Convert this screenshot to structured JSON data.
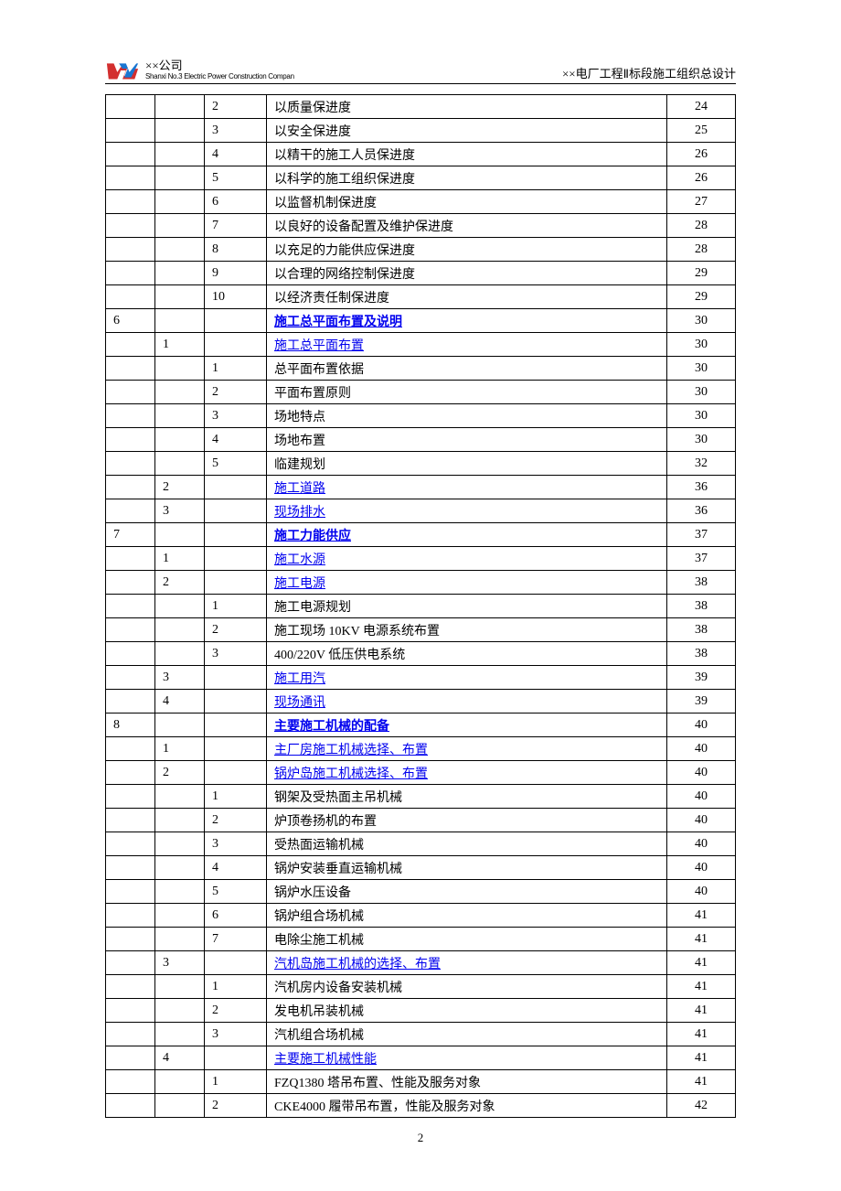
{
  "header": {
    "company_cn": "××公司",
    "company_en": "Shanxi No.3 Electric Power Construction Compan",
    "title_right": "××电厂工程Ⅱ标段施工组织总设计"
  },
  "rows": [
    {
      "c1": "",
      "c2": "",
      "c3": "2",
      "c4": "以质量保进度",
      "c5": "24",
      "link": false
    },
    {
      "c1": "",
      "c2": "",
      "c3": "3",
      "c4": "以安全保进度",
      "c5": "25",
      "link": false
    },
    {
      "c1": "",
      "c2": "",
      "c3": "4",
      "c4": "以精干的施工人员保进度",
      "c5": "26",
      "link": false
    },
    {
      "c1": "",
      "c2": "",
      "c3": "5",
      "c4": "以科学的施工组织保进度",
      "c5": "26",
      "link": false
    },
    {
      "c1": "",
      "c2": "",
      "c3": "6",
      "c4": "以监督机制保进度",
      "c5": "27",
      "link": false
    },
    {
      "c1": "",
      "c2": "",
      "c3": "7",
      "c4": "以良好的设备配置及维护保进度",
      "c5": "28",
      "link": false
    },
    {
      "c1": "",
      "c2": "",
      "c3": "8",
      "c4": "以充足的力能供应保进度",
      "c5": "28",
      "link": false
    },
    {
      "c1": "",
      "c2": "",
      "c3": "9",
      "c4": "以合理的网络控制保进度",
      "c5": "29",
      "link": false
    },
    {
      "c1": "",
      "c2": "",
      "c3": "10",
      "c4": "以经济责任制保进度",
      "c5": "29",
      "link": false
    },
    {
      "c1": "6",
      "c2": "",
      "c3": "",
      "c4": "施工总平面布置及说明",
      "c5": "30",
      "link": true,
      "bold": true
    },
    {
      "c1": "",
      "c2": "1",
      "c3": "",
      "c4": "施工总平面布置",
      "c5": "30",
      "link": true
    },
    {
      "c1": "",
      "c2": "",
      "c3": "1",
      "c4": "总平面布置依据",
      "c5": "30",
      "link": false
    },
    {
      "c1": "",
      "c2": "",
      "c3": "2",
      "c4": "平面布置原则",
      "c5": "30",
      "link": false
    },
    {
      "c1": "",
      "c2": "",
      "c3": "3",
      "c4": "场地特点",
      "c5": "30",
      "link": false
    },
    {
      "c1": "",
      "c2": "",
      "c3": "4",
      "c4": "场地布置",
      "c5": "30",
      "link": false
    },
    {
      "c1": "",
      "c2": "",
      "c3": "5",
      "c4": "临建规划",
      "c5": "32",
      "link": false
    },
    {
      "c1": "",
      "c2": "2",
      "c3": "",
      "c4": "施工道路",
      "c5": "36",
      "link": true
    },
    {
      "c1": "",
      "c2": "3",
      "c3": "",
      "c4": "现场排水",
      "c5": "36",
      "link": true
    },
    {
      "c1": "7",
      "c2": "",
      "c3": "",
      "c4": "施工力能供应",
      "c5": "37",
      "link": true,
      "bold": true
    },
    {
      "c1": "",
      "c2": "1",
      "c3": "",
      "c4": "施工水源",
      "c5": "37",
      "link": true
    },
    {
      "c1": "",
      "c2": "2",
      "c3": "",
      "c4": "施工电源",
      "c5": "38",
      "link": true
    },
    {
      "c1": "",
      "c2": "",
      "c3": "1",
      "c4": "施工电源规划",
      "c5": "38",
      "link": false
    },
    {
      "c1": "",
      "c2": "",
      "c3": "2",
      "c4": "施工现场 10KV 电源系统布置",
      "c5": "38",
      "link": false
    },
    {
      "c1": "",
      "c2": "",
      "c3": "3",
      "c4": "400/220V 低压供电系统",
      "c5": "38",
      "link": false
    },
    {
      "c1": "",
      "c2": "3",
      "c3": "",
      "c4": "施工用汽",
      "c5": "39",
      "link": true
    },
    {
      "c1": "",
      "c2": "4",
      "c3": "",
      "c4": "现场通讯",
      "c5": "39",
      "link": true
    },
    {
      "c1": "8",
      "c2": "",
      "c3": "",
      "c4": "主要施工机械的配备",
      "c5": "40",
      "link": true,
      "bold": true
    },
    {
      "c1": "",
      "c2": "1",
      "c3": "",
      "c4": "主厂房施工机械选择、布置",
      "c5": "40",
      "link": true
    },
    {
      "c1": "",
      "c2": "2",
      "c3": "",
      "c4": "锅炉岛施工机械选择、布置",
      "c5": "40",
      "link": true
    },
    {
      "c1": "",
      "c2": "",
      "c3": "1",
      "c4": "钢架及受热面主吊机械",
      "c5": "40",
      "link": false
    },
    {
      "c1": "",
      "c2": "",
      "c3": "2",
      "c4": "炉顶卷扬机的布置",
      "c5": "40",
      "link": false
    },
    {
      "c1": "",
      "c2": "",
      "c3": "3",
      "c4": "受热面运输机械",
      "c5": "40",
      "link": false
    },
    {
      "c1": "",
      "c2": "",
      "c3": "4",
      "c4": "锅炉安装垂直运输机械",
      "c5": "40",
      "link": false
    },
    {
      "c1": "",
      "c2": "",
      "c3": "5",
      "c4": "锅炉水压设备",
      "c5": "40",
      "link": false
    },
    {
      "c1": "",
      "c2": "",
      "c3": "6",
      "c4": "锅炉组合场机械",
      "c5": "41",
      "link": false
    },
    {
      "c1": "",
      "c2": "",
      "c3": "7",
      "c4": "电除尘施工机械",
      "c5": "41",
      "link": false
    },
    {
      "c1": "",
      "c2": "3",
      "c3": "",
      "c4": "汽机岛施工机械的选择、布置",
      "c5": "41",
      "link": true
    },
    {
      "c1": "",
      "c2": "",
      "c3": "1",
      "c4": "汽机房内设备安装机械",
      "c5": "41",
      "link": false
    },
    {
      "c1": "",
      "c2": "",
      "c3": "2",
      "c4": "发电机吊装机械",
      "c5": "41",
      "link": false
    },
    {
      "c1": "",
      "c2": "",
      "c3": "3",
      "c4": "汽机组合场机械",
      "c5": "41",
      "link": false
    },
    {
      "c1": "",
      "c2": "4",
      "c3": "",
      "c4": "主要施工机械性能",
      "c5": "41",
      "link": true
    },
    {
      "c1": "",
      "c2": "",
      "c3": "1",
      "c4": "FZQ1380 塔吊布置、性能及服务对象",
      "c5": "41",
      "link": false
    },
    {
      "c1": "",
      "c2": "",
      "c3": "2",
      "c4": "CKE4000 履带吊布置，性能及服务对象",
      "c5": "42",
      "link": false
    }
  ],
  "page_number": "2"
}
